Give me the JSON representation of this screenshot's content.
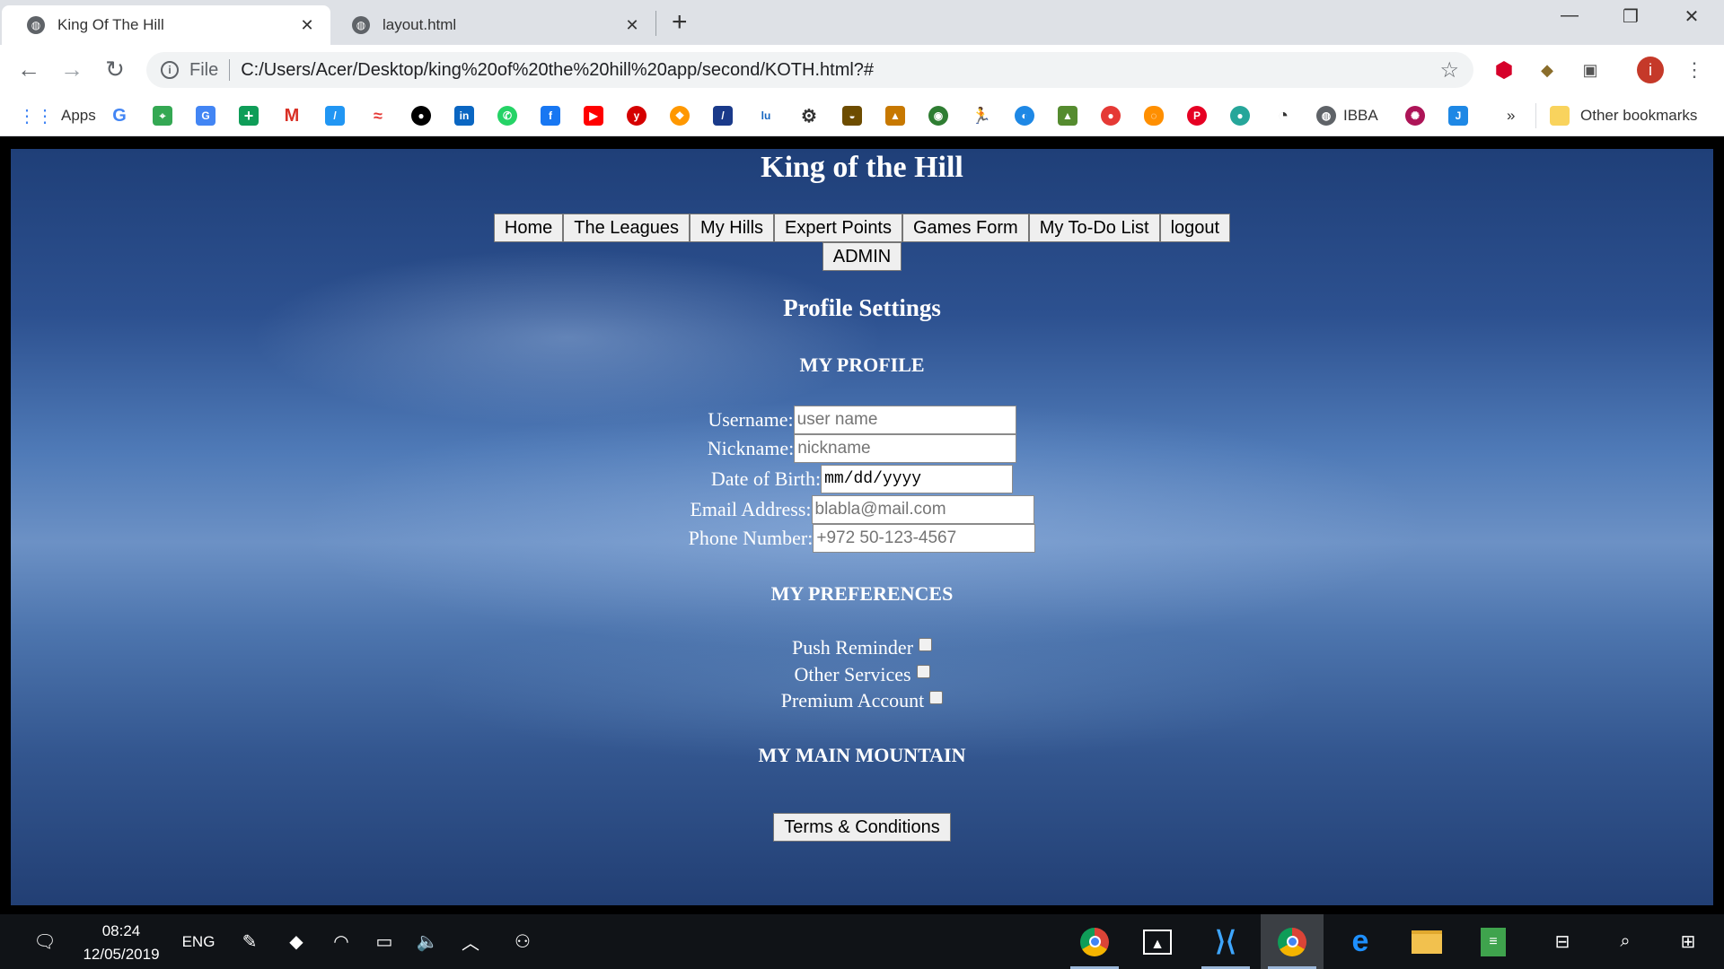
{
  "tabs": [
    {
      "title": "King Of The Hill",
      "active": true
    },
    {
      "title": "layout.html",
      "active": false
    }
  ],
  "toolbar": {
    "scheme_label": "File",
    "url": "C:/Users/Acer/Desktop/king%20of%20the%20hill%20app/second/KOTH.html?#"
  },
  "bookmarks": {
    "apps_label": "Apps",
    "ibba_label": "IBBA",
    "overflow_label": "»",
    "other_label": "Other bookmarks"
  },
  "site": {
    "title": "King of the Hill",
    "nav": [
      "Home",
      "The Leagues",
      "My Hills",
      "Expert Points",
      "Games Form",
      "My To-Do List",
      "logout"
    ],
    "admin_label": "ADMIN",
    "settings_title": "Profile Settings"
  },
  "profile": {
    "heading": "MY PROFILE",
    "username_label": "Username:",
    "username_placeholder": "user name",
    "nickname_label": "Nickname:",
    "nickname_placeholder": "nickname",
    "dob_label": "Date of Birth:",
    "dob_value": "mm/dd/yyyy",
    "email_label": "Email Address:",
    "email_placeholder": "blabla@mail.com",
    "phone_label": "Phone Number:",
    "phone_placeholder": "+972 50-123-4567"
  },
  "preferences": {
    "heading": "MY PREFERENCES",
    "push_label": "Push Reminder",
    "other_label": "Other Services",
    "premium_label": "Premium Account"
  },
  "mountain": {
    "heading": "MY MAIN MOUNTAIN"
  },
  "terms_label": "Terms & Conditions",
  "taskbar": {
    "time": "08:24",
    "date": "12/05/2019",
    "lang": "ENG"
  }
}
